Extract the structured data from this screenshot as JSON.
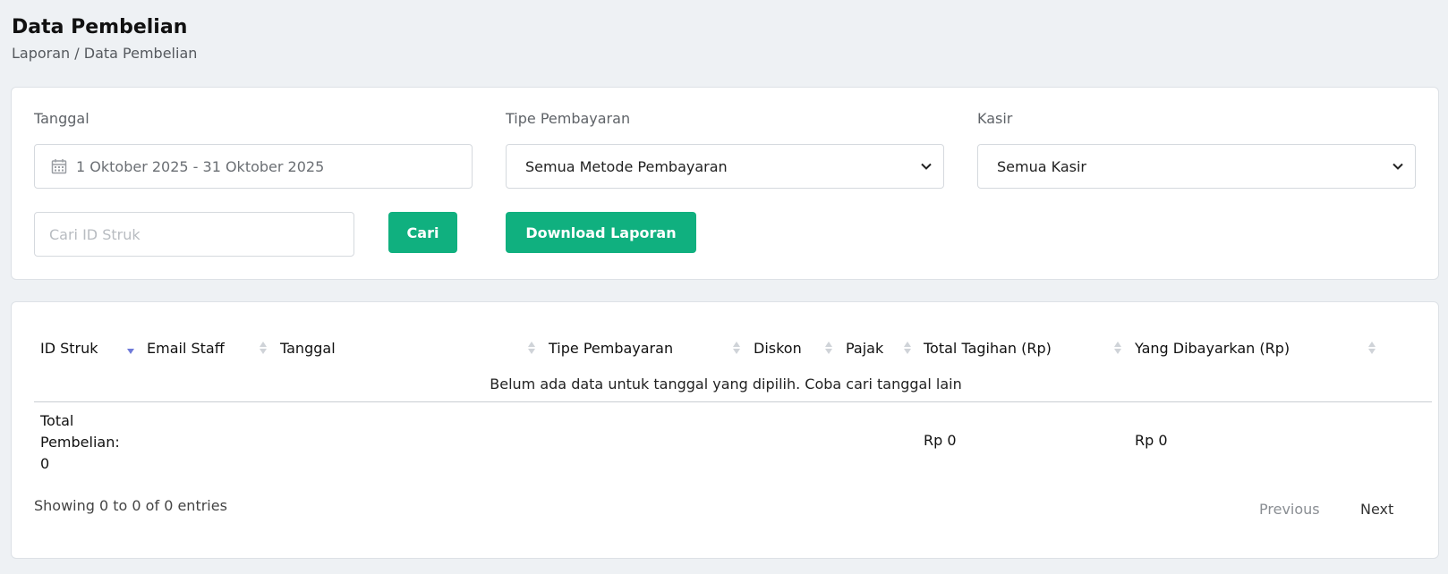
{
  "header": {
    "title": "Data Pembelian",
    "breadcrumb": "Laporan / Data Pembelian"
  },
  "filters": {
    "date_label": "Tanggal",
    "date_value": "1 Oktober 2025 - 31 Oktober 2025",
    "payment_label": "Tipe Pembayaran",
    "payment_value": "Semua Metode Pembayaran",
    "cashier_label": "Kasir",
    "cashier_value": "Semua Kasir",
    "search_placeholder": "Cari ID Struk",
    "search_button": "Cari",
    "download_button": "Download Laporan"
  },
  "table": {
    "columns": [
      "ID Struk",
      "Email Staff",
      "Tanggal",
      "Tipe Pembayaran",
      "Diskon",
      "Pajak",
      "Total Tagihan (Rp)",
      "Yang Dibayarkan (Rp)"
    ],
    "empty_message": "Belum ada data untuk tanggal yang dipilih. Coba cari tanggal lain",
    "footer": {
      "total_label_1": "Total",
      "total_label_2": "Pembelian:",
      "total_count": "0",
      "total_tagihan": "Rp 0",
      "total_dibayar": "Rp 0"
    },
    "info": "Showing 0 to 0 of 0 entries",
    "pagination": {
      "previous": "Previous",
      "next": "Next"
    }
  },
  "colors": {
    "accent": "#10b07f",
    "sort_active": "#6f7ad9"
  },
  "icons": [
    "calendar-icon",
    "chevron-down-icon",
    "sort-icon",
    "sort-desc-icon"
  ]
}
